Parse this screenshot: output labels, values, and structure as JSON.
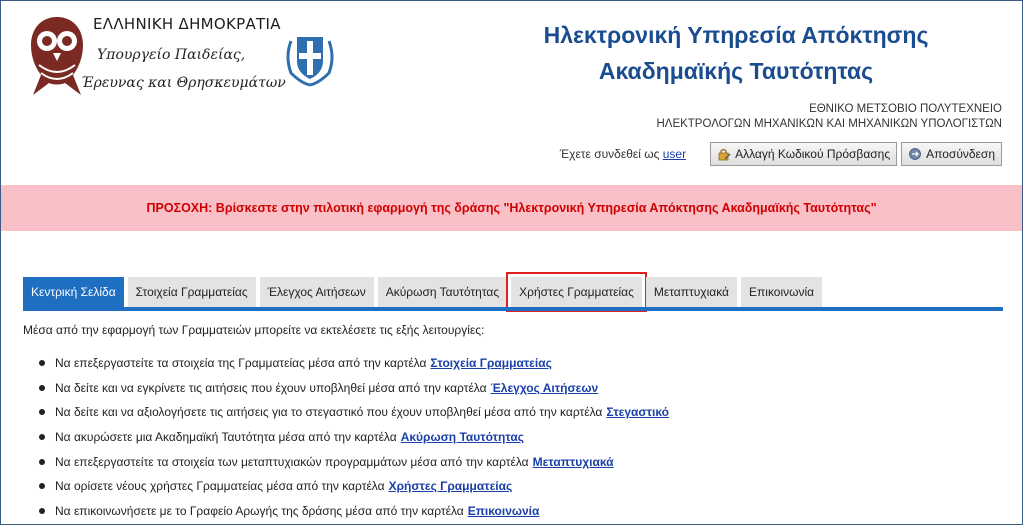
{
  "header": {
    "ministry_line1": "ΕΛΛΗΝΙΚΗ ΔΗΜΟΚΡΑΤΙΑ",
    "ministry_line2": "Υπουργείο Παιδείας,",
    "ministry_line3": "Έρευνας και Θρησκευμάτων",
    "title_line1": "Ηλεκτρονική Υπηρεσία Απόκτησης",
    "title_line2": "Ακαδημαϊκής Ταυτότητας",
    "institution": "ΕΘΝΙΚΟ ΜΕΤΣΟΒΙΟ ΠΟΛΥΤΕΧΝΕΙΟ",
    "department": "ΗΛΕΚΤΡΟΛΟΓΩΝ ΜΗΧΑΝΙΚΩΝ ΚΑΙ ΜΗΧΑΝΙΚΩΝ ΥΠΟΛΟΓΙΣΤΩΝ",
    "logged_in_text": "Έχετε συνδεθεί ως",
    "username": "user",
    "change_password_label": "Αλλαγή Κωδικού Πρόσβασης",
    "logout_label": "Αποσύνδεση"
  },
  "warning": {
    "text": "ΠΡΟΣΟΧΗ: Βρίσκεστε στην πιλοτική εφαρμογή της δράσης \"Ηλεκτρονική Υπηρεσία Απόκτησης Ακαδημαϊκής Ταυτότητας\""
  },
  "tabs": [
    {
      "label": "Κεντρική Σελίδα"
    },
    {
      "label": "Στοιχεία Γραμματείας"
    },
    {
      "label": "Έλεγχος Αιτήσεων"
    },
    {
      "label": "Ακύρωση Ταυτότητας"
    },
    {
      "label": "Χρήστες Γραμματείας"
    },
    {
      "label": "Μεταπτυχιακά"
    },
    {
      "label": "Επικοινωνία"
    }
  ],
  "content": {
    "intro": "Μέσα από την εφαρμογή των Γραμματειών μπορείτε να εκτελέσετε τις εξής λειτουργίες:",
    "items": [
      {
        "text": "Να επεξεργαστείτε τα στοιχεία της Γραμματείας μέσα από την καρτέλα",
        "link": "Στοιχεία Γραμματείας"
      },
      {
        "text": "Να δείτε και να εγκρίνετε τις αιτήσεις που έχουν υποβληθεί μέσα από την καρτέλα",
        "link": "Έλεγχος Αιτήσεων"
      },
      {
        "text": "Να δείτε και να αξιολογήσετε τις αιτήσεις για το στεγαστικό που έχουν υποβληθεί μέσα από την καρτέλα",
        "link": "Στεγαστικό"
      },
      {
        "text": "Να ακυρώσετε μια Ακαδημαϊκή Ταυτότητα μέσα από την καρτέλα",
        "link": "Ακύρωση Ταυτότητας"
      },
      {
        "text": "Να επεξεργαστείτε τα στοιχεία των μεταπτυχιακών προγραμμάτων μέσα από την καρτέλα",
        "link": "Μεταπτυχιακά"
      },
      {
        "text": "Να ορίσετε νέους χρήστες Γραμματείας μέσα από την καρτέλα",
        "link": "Χρήστες Γραμματείας"
      },
      {
        "text": "Να επικοινωνήσετε με το Γραφείο Αρωγής της δράσης μέσα από την καρτέλα",
        "link": "Επικοινωνία"
      }
    ]
  },
  "colors": {
    "title_blue": "#1a4d8f",
    "tab_active": "#1e6ec2",
    "warning_bg": "#f9c0c7",
    "warning_text": "#d10000",
    "link": "#1a3fa8",
    "highlight_box": "#e02020"
  },
  "icons": {
    "owl": "owl-logo-icon",
    "emblem": "greek-emblem-icon",
    "change_password": "lock-edit-icon",
    "logout": "logout-icon"
  }
}
